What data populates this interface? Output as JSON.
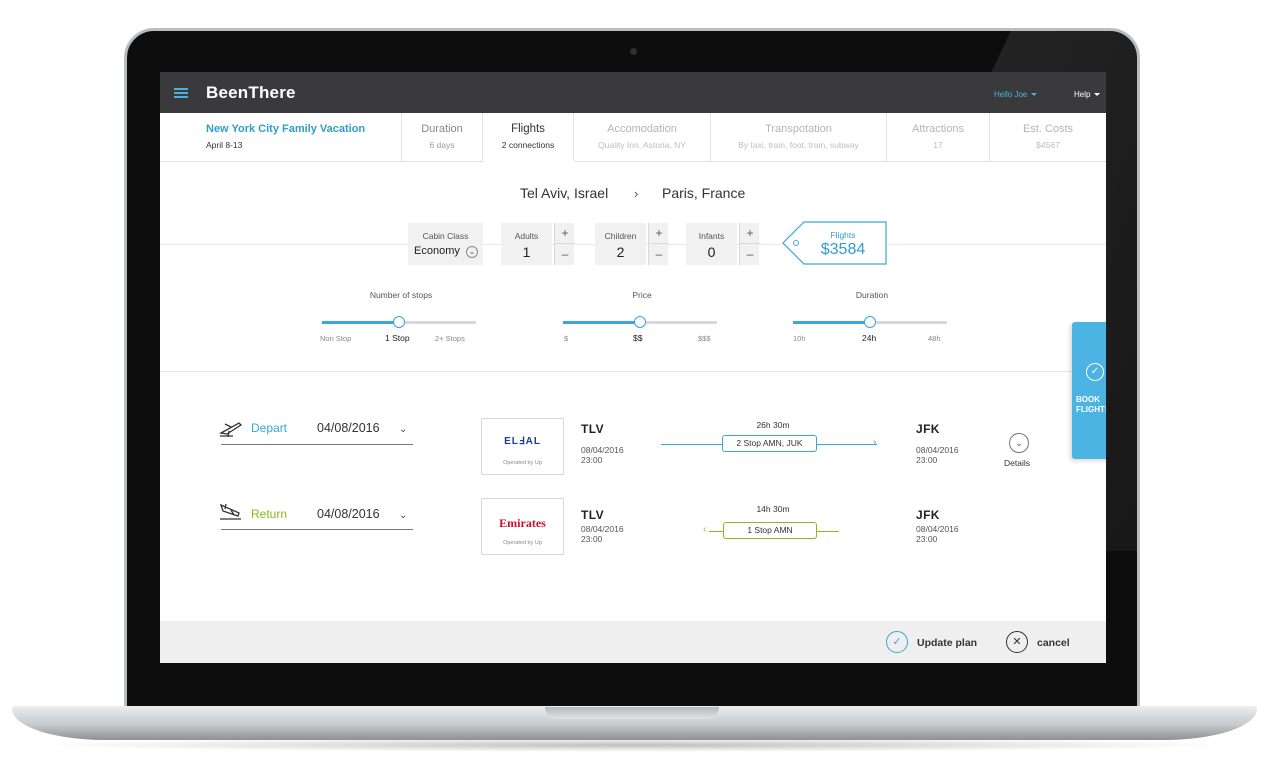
{
  "header": {
    "app_name": "BeenThere",
    "user_menu": "Hello Joe",
    "help_menu": "Help"
  },
  "tabs": [
    {
      "label": "New York City Family Vacation",
      "sub": "April 8-13"
    },
    {
      "label": "Duration",
      "sub": "6 days"
    },
    {
      "label": "Flights",
      "sub": "2 connections"
    },
    {
      "label": "Accomodation",
      "sub": "Quality Inn, Astoria, NY"
    },
    {
      "label": "Transpotation",
      "sub": "By taxi, train, foot, train, subway"
    },
    {
      "label": "Attractions",
      "sub": "17"
    },
    {
      "label": "Est. Costs",
      "sub": "$4567"
    }
  ],
  "route": {
    "from": "Tel Aviv, Israel",
    "separator": "›",
    "to": "Paris, France"
  },
  "passengers": {
    "cabin_class": {
      "label": "Cabin Class",
      "value": "Economy"
    },
    "adults": {
      "label": "Adults",
      "value": "1"
    },
    "children": {
      "label": "Children",
      "value": "2"
    },
    "infants": {
      "label": "Infants",
      "value": "0"
    },
    "plus_glyph": "+",
    "minus_glyph": "–"
  },
  "price_tag": {
    "label": "Flights",
    "value": "$3584"
  },
  "filters": [
    {
      "title": "Number of stops",
      "ticks": [
        "Non Stop",
        "1 Stop",
        "2+ Stops"
      ],
      "selected_index": 1,
      "level": 0.5
    },
    {
      "title": "Price",
      "ticks": [
        "$",
        "$$",
        "$$$"
      ],
      "selected_index": 1,
      "level": 0.5
    },
    {
      "title": "Duration",
      "ticks": [
        "10h",
        "24h",
        "48h"
      ],
      "selected_index": 1,
      "level": 0.5
    }
  ],
  "flights": {
    "depart": {
      "label": "Depart",
      "date": "04/08/2016",
      "airline": "ELℲAL",
      "operated_by": "Operated by Up",
      "origin_code": "TLV",
      "origin_date": "08/04/2016",
      "origin_time": "23:00",
      "duration": "26h 30m",
      "stops": "2 Stop AMN, JUK",
      "dest_code": "JFK",
      "dest_date": "08/04/2016",
      "dest_time": "23:00",
      "details_label": "Details",
      "color": "#3aa7d6"
    },
    "return": {
      "label": "Return",
      "date": "04/08/2016",
      "airline": "Emirates",
      "operated_by": "Operated by Up",
      "origin_code": "TLV",
      "origin_date": "08/04/2016",
      "origin_time": "23:00",
      "duration": "14h 30m",
      "stops": "1 Stop AMN",
      "dest_code": "JFK",
      "dest_date": "08/04/2016",
      "dest_time": "23:00",
      "color": "#8dbb1a"
    }
  },
  "book_tab": {
    "label": "BOOK FLIGHTS"
  },
  "footer": {
    "update_label": "Update plan",
    "cancel_label": "cancel"
  },
  "colors": {
    "accent": "#3aa7d6",
    "return_green": "#8dbb1a",
    "topbar": "#3a3a3c"
  }
}
